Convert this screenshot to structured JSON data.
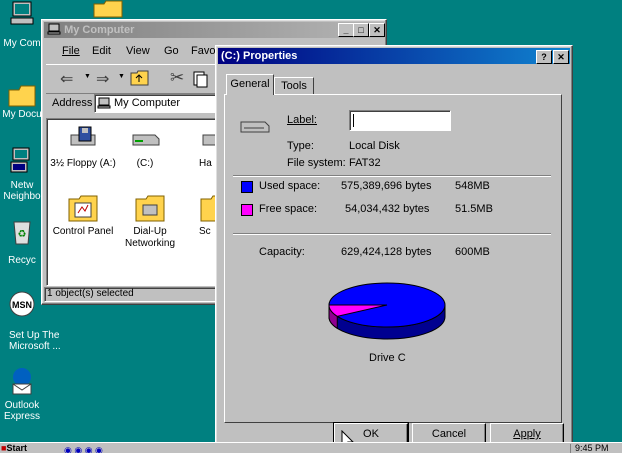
{
  "desktop": {
    "icons": [
      {
        "label": "My Com",
        "icon": "my-computer-icon"
      },
      {
        "label": "My Docu",
        "icon": "my-documents-icon"
      },
      {
        "label": "Netw Neighbo",
        "icon": "network-neighborhood-icon"
      },
      {
        "label": "Recyc",
        "icon": "recycle-bin-icon"
      },
      {
        "label": "Set Up The Microsoft ...",
        "icon": "msn-icon"
      },
      {
        "label": "Outlook Express",
        "icon": "outlook-express-icon"
      }
    ]
  },
  "mycomputer": {
    "title": "My Computer",
    "menu": [
      "File",
      "Edit",
      "View",
      "Go",
      "Favo"
    ],
    "address_label": "Address",
    "address_value": "My Computer",
    "items": [
      {
        "label": "3½ Floppy (A:)",
        "icon": "floppy-drive-icon"
      },
      {
        "label": "(C:)",
        "icon": "hard-drive-icon"
      },
      {
        "label": "Ha",
        "icon": "hard-drive-icon"
      },
      {
        "label": "Control Panel",
        "icon": "control-panel-icon"
      },
      {
        "label": "Dial-Up Networking",
        "icon": "dialup-networking-icon"
      },
      {
        "label": "Sc",
        "icon": "scheduled-tasks-icon"
      }
    ],
    "status": "1 object(s) selected"
  },
  "properties": {
    "title": "(C:) Properties",
    "tabs": [
      "General",
      "Tools"
    ],
    "label_caption": "Label:",
    "label_value": "",
    "type_caption": "Type:",
    "type_value": "Local Disk",
    "fs_caption": "File system:",
    "fs_value": "FAT32",
    "used_caption": "Used space:",
    "used_bytes": "575,389,696 bytes",
    "used_mb": "548MB",
    "free_caption": "Free space:",
    "free_bytes": "54,034,432 bytes",
    "free_mb": "51.5MB",
    "capacity_caption": "Capacity:",
    "capacity_bytes": "629,424,128 bytes",
    "capacity_mb": "600MB",
    "drive_caption": "Drive C",
    "used_color": "#0000ff",
    "free_color": "#ff00ff",
    "used_fraction": 0.914,
    "ok_label": "OK",
    "cancel_label": "Cancel",
    "apply_label": "Apply"
  },
  "taskbar": {
    "start_label": "Start",
    "clock": "9:45 PM"
  }
}
